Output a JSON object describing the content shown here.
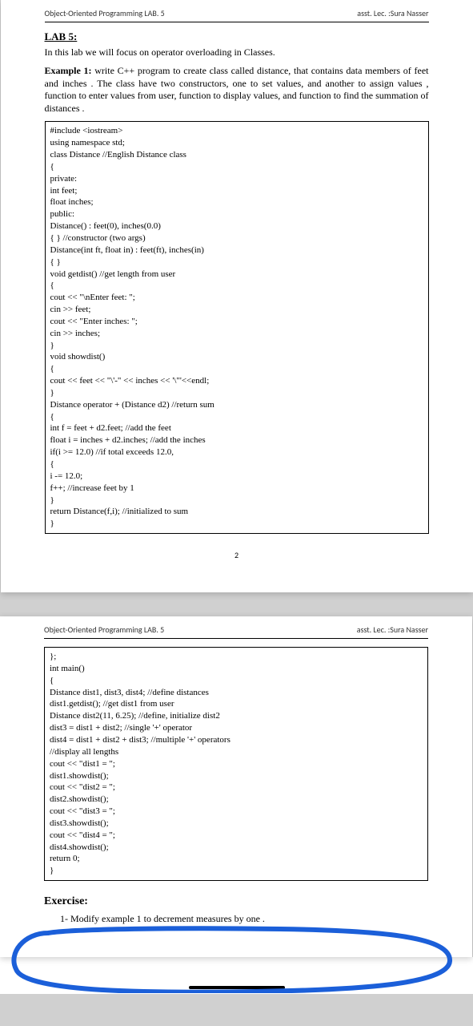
{
  "header": {
    "left": "Object-Oriented Programming LAB. 5",
    "right": "asst. Lec. :Sura Nasser"
  },
  "labTitle": "LAB 5:",
  "intro": "In this lab we will focus on operator overloading in Classes.",
  "exampleLabel": "Example 1:",
  "exampleText": " write C++ program to create class called distance, that contains data members of feet and inches . The class have two constructors, one to set values, and another to assign values , function to enter values from user, function to display values, and function to find the summation of distances .",
  "code1": "#include <iostream>\nusing namespace std;\nclass Distance //English Distance class\n{\nprivate:\nint feet;\nfloat inches;\npublic:\nDistance() : feet(0), inches(0.0)\n{ } //constructor (two args)\nDistance(int ft, float in) : feet(ft), inches(in)\n{ }\nvoid getdist() //get length from user\n{\ncout << \"\\nEnter feet: \";\ncin >> feet;\ncout << \"Enter inches: \";\ncin >> inches;\n}\nvoid showdist()\n{\ncout << feet << \"\\'-\" << inches << '\\\"'<<endl;\n}\nDistance operator + (Distance d2) //return sum\n{\nint f = feet + d2.feet; //add the feet\nfloat i = inches + d2.inches; //add the inches\nif(i >= 12.0) //if total exceeds 12.0,\n{\ni -= 12.0;\nf++; //increase feet by 1\n}\nreturn Distance(f,i); //initialized to sum\n}",
  "pageNum1": "2",
  "code2": "};\nint main()\n{\nDistance dist1, dist3, dist4; //define distances\ndist1.getdist(); //get dist1 from user\nDistance dist2(11, 6.25); //define, initialize dist2\ndist3 = dist1 + dist2; //single '+' operator\ndist4 = dist1 + dist2 + dist3; //multiple '+' operators\n//display all lengths\ncout << \"dist1 = \";\ndist1.showdist();\ncout << \"dist2 = \";\ndist2.showdist();\ncout << \"dist3 = \";\ndist3.showdist();\ncout << \"dist4 = \";\ndist4.showdist();\nreturn 0;\n}",
  "exerciseTitle": "Exercise:",
  "exerciseItem": "1-  Modify example 1 to decrement measures by one ."
}
